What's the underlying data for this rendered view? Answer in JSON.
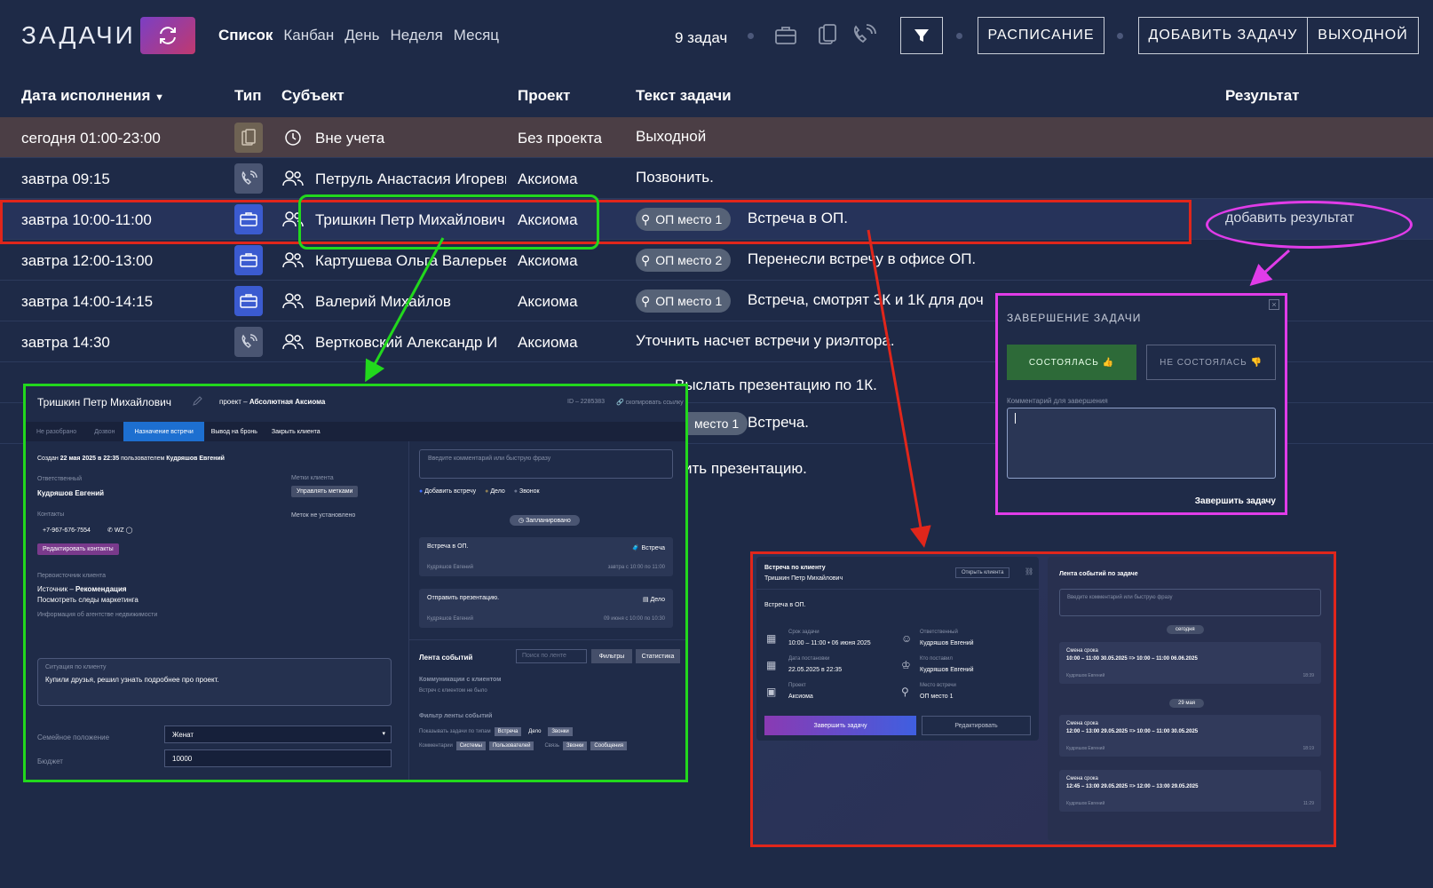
{
  "header": {
    "title": "ЗАДАЧИ",
    "views": [
      "Список",
      "Канбан",
      "День",
      "Неделя",
      "Месяц"
    ],
    "task_count": "9 задач",
    "schedule_btn": "РАСПИСАНИЕ",
    "add_btn": "ДОБАВИТЬ ЗАДАЧУ",
    "dayoff_btn": "ВЫХОДНОЙ"
  },
  "columns": {
    "date": "Дата исполнения",
    "type": "Тип",
    "subject": "Субъект",
    "project": "Проект",
    "text": "Текст задачи",
    "result": "Результат"
  },
  "rows": [
    {
      "date": "сегодня 01:00-23:00",
      "subject": "Вне учета",
      "project": "Без проекта",
      "text": "Выходной",
      "badge": ""
    },
    {
      "date": "завтра 09:15",
      "subject": "Петруль Анастасия Игоревна",
      "project": "Аксиома",
      "text": "Позвонить.",
      "badge": ""
    },
    {
      "date": "завтра 10:00-11:00",
      "subject": "Тришкин Петр Михайлович",
      "project": "Аксиома",
      "text": "Встреча в ОП.",
      "badge": "ОП место 1"
    },
    {
      "date": "завтра 12:00-13:00",
      "subject": "Картушева Ольга Валерьевна",
      "project": "Аксиома",
      "text": "Перенесли встречу в офисе ОП.",
      "badge": "ОП место 2"
    },
    {
      "date": "завтра 14:00-14:15",
      "subject": "Валерий Михайлов",
      "project": "Аксиома",
      "text": "Встреча, смотрят 3К и 1К для доч",
      "badge": "ОП место 1"
    },
    {
      "date": "завтра 14:30",
      "subject": "Вертковский Александр И",
      "project": "Аксиома",
      "text": "Уточнить насчет встречи у риэлтора.",
      "badge": ""
    },
    {
      "date": "",
      "subject": "",
      "project": "",
      "text": "Выслать презентацию по 1К.",
      "badge": ""
    },
    {
      "date": "",
      "subject": "",
      "project": "",
      "text": "Встреча.",
      "badge": "место 1"
    },
    {
      "date": "",
      "subject": "",
      "project": "",
      "text": "ить презентацию.",
      "badge": ""
    }
  ],
  "add_result": "добавить результат",
  "complete_modal": {
    "title": "ЗАВЕРШЕНИЕ ЗАДАЧИ",
    "done": "СОСТОЯЛАСЬ 👍",
    "not_done": "НЕ СОСТОЯЛАСЬ 👎",
    "comment_label": "Комментарий для завершения",
    "submit": "Завершить задачу"
  },
  "client_card": {
    "name": "Тришкин Петр Михайлович",
    "project_prefix": "проект – ",
    "project": "Абсолютная Аксиома",
    "id": "ID – 2285383",
    "copy": "скопировать ссылку",
    "stages": [
      "Не разобрано",
      "Дозвон",
      "Назначение встречи",
      "Вывод на бронь",
      "Закрыть клиента"
    ],
    "created_prefix": "Создан ",
    "created_date": "22 мая 2025 в 22:35",
    "created_mid": " пользователем ",
    "created_user": "Кудряшов Евгений",
    "responsible_label": "Ответственный",
    "responsible": "Кудряшов Евгений",
    "tags_label": "Метки клиента",
    "tags_btn": "Управлять метками",
    "no_tags": "Меток не установлено",
    "contacts_label": "Контакты",
    "phone": "+7-967-676-7554",
    "wz": "WZ",
    "edit_contacts": "Редактировать контакты",
    "source_label": "Первоисточник клиента",
    "source_prefix": "Источник – ",
    "source": "Рекомендация",
    "marketing": "Посмотреть следы маркетинга",
    "agency_info": "Информация об агентстве недвижимости",
    "situation_label": "Ситуация по клиенту",
    "situation": "Купили друзья, решил узнать подробнее про проект.",
    "family_label": "Семейное положение",
    "family": "Женат",
    "budget_label": "Бюджет",
    "budget": "10000",
    "comment_ph": "Введите комментарий или быструю фразу",
    "opts": [
      "Добавить встречу",
      "Дело",
      "Звонок"
    ],
    "planned": "Запланировано",
    "tasks": [
      {
        "title": "Встреча в ОП.",
        "tag": "Встреча",
        "user": "Кудряшов Евгений",
        "when": "завтра с 10:00 по 11:00"
      },
      {
        "title": "Отправить презентацию.",
        "tag": "Дело",
        "user": "Кудряшов Евгений",
        "when": "09 июня с 10:00 по 10:30"
      }
    ],
    "feed_title": "Лента событий",
    "feed_search": "Поиск по ленте",
    "filters": "Фильтры",
    "stats": "Статистика",
    "comm_title": "Коммуникации с клиентом",
    "comm_none": "Встреч с клиентом не было",
    "filter_title": "Фильтр ленты событий",
    "show_types": "Показывать задачи по типам",
    "types": [
      "Встреча",
      "Дело",
      "Звонки"
    ],
    "comments_label": "Комментарии",
    "comment_types": [
      "Системы",
      "Пользователей"
    ],
    "link_label": "Связь",
    "link_types": [
      "Звонки",
      "Сообщения"
    ]
  },
  "task_detail": {
    "title": "Встреча по клиенту",
    "client": "Тришкин Петр Михайлович",
    "open_client": "Открыть клиента",
    "text": "Встреча в ОП.",
    "due_label": "Срок задачи",
    "due": "10:00 – 11:00 • 06 июня 2025",
    "resp_label": "Ответственный",
    "resp": "Кудряшов Евгений",
    "set_label": "Дата постановки",
    "set": "22.05.2025 в 22:35",
    "who_label": "Кто поставил",
    "who": "Кудряшов Евгений",
    "proj_label": "Проект",
    "proj": "Аксиома",
    "place_label": "Место встречи",
    "place": "ОП место 1",
    "complete": "Завершить задачу",
    "edit": "Редактировать",
    "feed_title": "Лента событий по задаче",
    "feed_ph": "Введите комментарий или быструю фразу",
    "today": "сегодня",
    "may29": "29 мая",
    "events": [
      {
        "title": "Смена срока",
        "text": "10:00 – 11:00 30.05.2025 => 10:00 – 11:00 06.06.2025",
        "user": "Кудряшов Евгений",
        "time": "18:39"
      },
      {
        "title": "Смена срока",
        "text": "12:00 – 13:00 29.05.2025 => 10:00 – 11:00 30.05.2025",
        "user": "Кудряшов Евгений",
        "time": "18:19"
      },
      {
        "title": "Смена срока",
        "text": "12:45 – 13:00 29.05.2025 => 12:00 – 13:00 29.05.2025",
        "user": "Кудряшов Евгений",
        "time": "11:29"
      }
    ]
  },
  "colors": {
    "bg": "#1e2a47",
    "highlight": "#e0261b",
    "green": "#22d81d",
    "magenta": "#e03ce8",
    "accent": "#7b3fc4"
  }
}
